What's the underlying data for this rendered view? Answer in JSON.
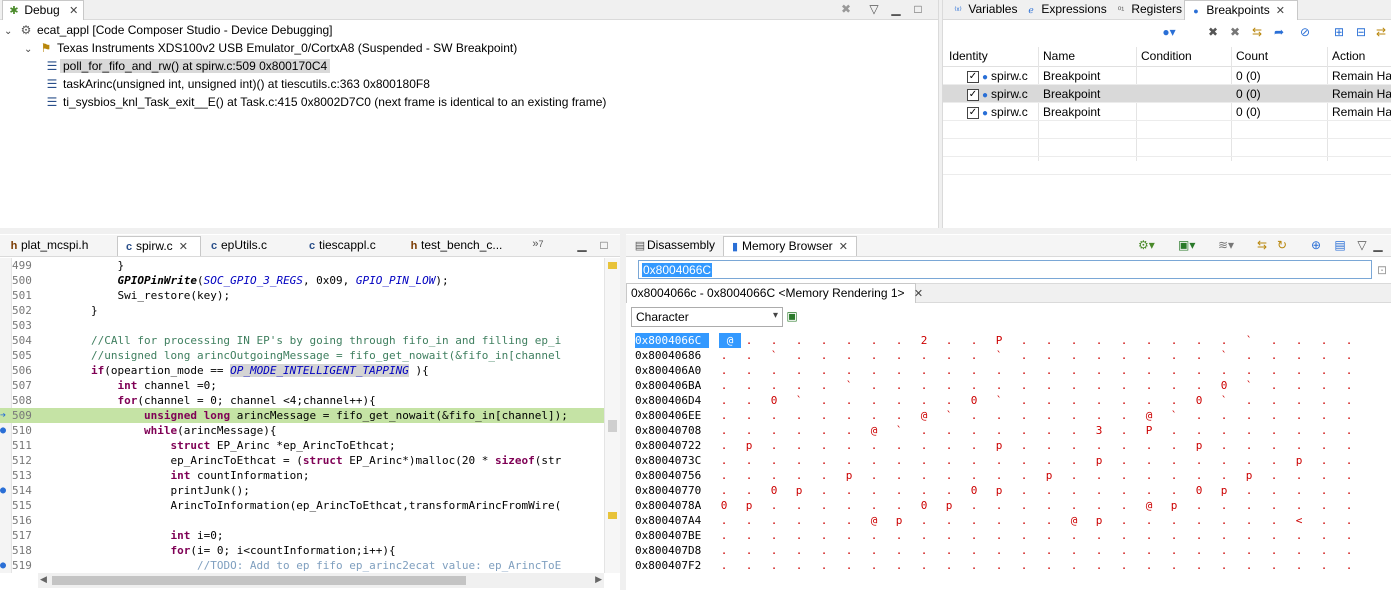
{
  "debug_view": {
    "tab_label": "Debug",
    "tree": [
      {
        "indent": 0,
        "icon": "gear-icon",
        "label": "ecat_appl [Code Composer Studio - Device Debugging]"
      },
      {
        "indent": 1,
        "icon": "thread-icon",
        "label": "Texas Instruments XDS100v2 USB Emulator_0/CortxA8 (Suspended - SW Breakpoint)"
      },
      {
        "indent": 2,
        "icon": "stack-frame-icon",
        "label": "poll_for_fifo_and_rw() at spirw.c:509 0x800170C4",
        "selected": true
      },
      {
        "indent": 2,
        "icon": "stack-frame-icon",
        "label": "taskArinc(unsigned int, unsigned int)() at tiescutils.c:363 0x800180F8"
      },
      {
        "indent": 2,
        "icon": "stack-frame-icon",
        "label": "ti_sysbios_knl_Task_exit__E() at Task.c:415 0x8002D7C0  (next frame is identical to an existing frame)"
      }
    ]
  },
  "right_panel": {
    "tabs": [
      {
        "label": "Variables",
        "icon": "variables-icon"
      },
      {
        "label": "Expressions",
        "icon": "expressions-icon"
      },
      {
        "label": "Registers",
        "icon": "registers-icon"
      },
      {
        "label": "Breakpoints",
        "icon": "breakpoints-icon",
        "active": true
      }
    ],
    "columns": [
      "Identity",
      "Name",
      "Condition",
      "Count",
      "Action"
    ],
    "rows": [
      {
        "identity": "spirw.c",
        "name": "Breakpoint",
        "condition": "",
        "count": "0 (0)",
        "action": "Remain Halted"
      },
      {
        "identity": "spirw.c",
        "name": "Breakpoint",
        "condition": "",
        "count": "0 (0)",
        "action": "Remain Halted",
        "selected": true
      },
      {
        "identity": "spirw.c",
        "name": "Breakpoint",
        "condition": "",
        "count": "0 (0)",
        "action": "Remain Halted"
      }
    ]
  },
  "editor": {
    "tabs": [
      {
        "label": "plat_mcspi.h",
        "icon": "h-file-icon"
      },
      {
        "label": "spirw.c",
        "icon": "c-file-icon",
        "active": true
      },
      {
        "label": "epUtils.c",
        "icon": "c-file-icon"
      },
      {
        "label": "tiescappl.c",
        "icon": "c-file-icon"
      },
      {
        "label": "test_bench_c...",
        "icon": "h-file-icon"
      }
    ],
    "overflow_label": "7",
    "lines": [
      {
        "n": "499",
        "code": "            }"
      },
      {
        "n": "500",
        "code": "            GPIOPinWrite(SOC_GPIO_3_REGS, 0x09, GPIO_PIN_LOW);"
      },
      {
        "n": "501",
        "code": "            Swi_restore(key);"
      },
      {
        "n": "502",
        "code": "        }"
      },
      {
        "n": "503",
        "code": ""
      },
      {
        "n": "504",
        "code": "        //CAll for processing IN EP's by going through fifo_in and filling ep_i"
      },
      {
        "n": "505",
        "code": "        //unsigned long arincOutgoingMessage = fifo_get_nowait(&fifo_in[channel"
      },
      {
        "n": "506",
        "code": "        if(opeartion_mode == OP_MODE_INTELLIGENT_TAPPING ){"
      },
      {
        "n": "507",
        "code": "            int channel =0;"
      },
      {
        "n": "508",
        "code": "            for(channel = 0; channel <4;channel++){"
      },
      {
        "n": "509",
        "code": "                unsigned long arincMessage = fifo_get_nowait(&fifo_in[channel]);",
        "current": true
      },
      {
        "n": "510",
        "code": "                while(arincMessage){"
      },
      {
        "n": "511",
        "code": "                    struct EP_Arinc *ep_ArincToEthcat;"
      },
      {
        "n": "512",
        "code": "                    ep_ArincToEthcat = (struct EP_Arinc*)malloc(20 * sizeof(str"
      },
      {
        "n": "513",
        "code": "                    int countInformation;"
      },
      {
        "n": "514",
        "code": "                    printJunk();"
      },
      {
        "n": "515",
        "code": "                    ArincToInformation(ep_ArincToEthcat,transformArincFromWire("
      },
      {
        "n": "516",
        "code": ""
      },
      {
        "n": "517",
        "code": "                    int i=0;"
      },
      {
        "n": "518",
        "code": "                    for(i= 0; i<countInformation;i++){"
      },
      {
        "n": "519",
        "code": "                        //TODO: Add to ep fifo ep_arinc2ecat value: ep_ArincToE"
      }
    ]
  },
  "memory_panel": {
    "tabs": [
      {
        "label": "Disassembly",
        "icon": "disassembly-icon"
      },
      {
        "label": "Memory Browser",
        "icon": "memory-icon",
        "active": true
      }
    ],
    "address_input": "0x8004066C",
    "rendering_tab": "0x8004066c - 0x8004066C <Memory Rendering 1>",
    "format_select": "Character",
    "rows": [
      {
        "addr": "0x8004066C",
        "chars": "@.......2..P.........`........."
      },
      {
        "addr": "0x80040686",
        "chars": "..`........`........`........."
      },
      {
        "addr": "0x800406A0",
        "chars": "..............................."
      },
      {
        "addr": "0x800406BA",
        "chars": ".....`..............0`........"
      },
      {
        "addr": "0x800406D4",
        "chars": "..0`......0`.......0`........."
      },
      {
        "addr": "0x800406EE",
        "chars": "........@`.......@`.......@`.."
      },
      {
        "addr": "0x80040708",
        "chars": "......@`.......3.P............."
      },
      {
        "addr": "0x80040722",
        "chars": ".p.........p.......p.......p.."
      },
      {
        "addr": "0x8004073C",
        "chars": "...............p.......p......"
      },
      {
        "addr": "0x80040756",
        "chars": ".....p.......p.......p........"
      },
      {
        "addr": "0x80040770",
        "chars": "..0p......0p.......0p........."
      },
      {
        "addr": "0x8004078A",
        "chars": "0p......0p.......@p.......@p.."
      },
      {
        "addr": "0x800407A4",
        "chars": "......@p......@p.......<......"
      },
      {
        "addr": "0x800407BE",
        "chars": "..............................."
      },
      {
        "addr": "0x800407D8",
        "chars": "..............................."
      },
      {
        "addr": "0x800407F2",
        "chars": "..............................."
      }
    ]
  },
  "colors": {
    "accent": "#0078d7",
    "current_line": "#c5e3a5",
    "memory_char": "#cc0000",
    "keyword": "#7f0055",
    "comment": "#3f7f5f"
  }
}
